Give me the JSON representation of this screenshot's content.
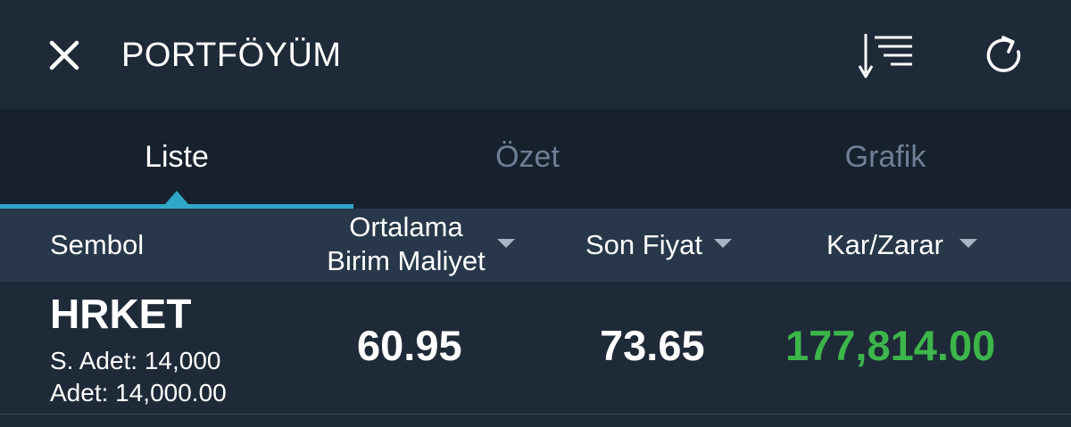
{
  "header": {
    "title": "PORTFÖYÜM",
    "close_icon": "close-icon",
    "sort_icon": "sort-descending-icon",
    "refresh_icon": "refresh-icon"
  },
  "tabs": [
    {
      "label": "Liste",
      "active": true
    },
    {
      "label": "Özet",
      "active": false
    },
    {
      "label": "Grafik",
      "active": false
    }
  ],
  "columns": {
    "symbol": "Sembol",
    "avg_cost_line1": "Ortalama",
    "avg_cost_line2": "Birim Maliyet",
    "last_price": "Son Fiyat",
    "profit_loss": "Kar/Zarar"
  },
  "rows": [
    {
      "symbol": "HRKET",
      "s_adet": "S. Adet: 14,000",
      "adet": "Adet: 14,000.00",
      "avg_cost": "60.95",
      "last_price": "73.65",
      "profit_loss": "177,814.00"
    }
  ],
  "colors": {
    "background": "#1f2a38",
    "tab_bar": "#17212d",
    "header_row": "#28384a",
    "accent": "#2fa6c8",
    "profit": "#3cb54a",
    "inactive_tab": "#6f7f95"
  }
}
